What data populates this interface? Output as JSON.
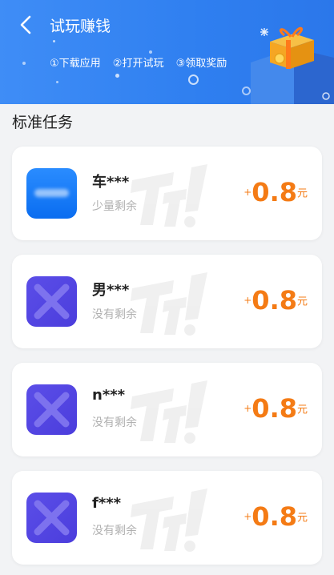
{
  "header": {
    "title": "试玩赚钱",
    "steps": [
      "①下载应用",
      "②打开试玩",
      "③领取奖励"
    ]
  },
  "section": {
    "title": "标准任务"
  },
  "tasks": [
    {
      "name": "车***",
      "status": "少量剩余",
      "plus": "+",
      "reward": "0.8",
      "unit": "元",
      "icon": "blurred-app-icon"
    },
    {
      "name": "男***",
      "status": "没有剩余",
      "plus": "+",
      "reward": "0.8",
      "unit": "元",
      "icon": "placeholder-x-icon"
    },
    {
      "name": "n***",
      "status": "没有剩余",
      "plus": "+",
      "reward": "0.8",
      "unit": "元",
      "icon": "placeholder-x-icon"
    },
    {
      "name": "f***",
      "status": "没有剩余",
      "plus": "+",
      "reward": "0.8",
      "unit": "元",
      "icon": "placeholder-x-icon"
    }
  ],
  "colors": {
    "header": "#2f7ff0",
    "reward": "#f47b15",
    "status": "#b0b0b0",
    "background": "#f2f3f5"
  }
}
